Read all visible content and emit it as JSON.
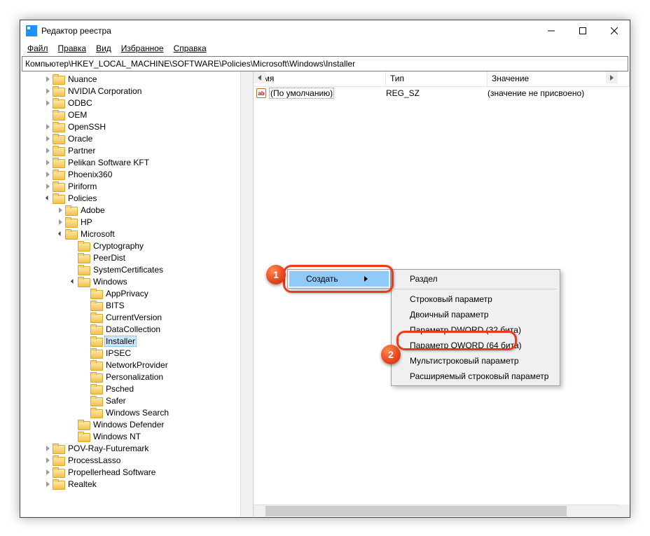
{
  "window": {
    "title": "Редактор реестра"
  },
  "menu": {
    "file": "Файл",
    "edit": "Правка",
    "view": "Вид",
    "favorites": "Избранное",
    "help": "Справка"
  },
  "address": "Компьютер\\HKEY_LOCAL_MACHINE\\SOFTWARE\\Policies\\Microsoft\\Windows\\Installer",
  "columns": {
    "name": "Имя",
    "type": "Тип",
    "value": "Значение"
  },
  "rows": [
    {
      "name": "(По умолчанию)",
      "type": "REG_SZ",
      "value": "(значение не присвоено)"
    }
  ],
  "tree": [
    {
      "d": 4,
      "tw": "closed",
      "label": "Nuance"
    },
    {
      "d": 4,
      "tw": "closed",
      "label": "NVIDIA Corporation"
    },
    {
      "d": 4,
      "tw": "closed",
      "label": "ODBC"
    },
    {
      "d": 4,
      "tw": "none",
      "label": "OEM"
    },
    {
      "d": 4,
      "tw": "closed",
      "label": "OpenSSH"
    },
    {
      "d": 4,
      "tw": "closed",
      "label": "Oracle"
    },
    {
      "d": 4,
      "tw": "closed",
      "label": "Partner"
    },
    {
      "d": 4,
      "tw": "closed",
      "label": "Pelikan Software KFT"
    },
    {
      "d": 4,
      "tw": "closed",
      "label": "Phoenix360"
    },
    {
      "d": 4,
      "tw": "closed",
      "label": "Piriform"
    },
    {
      "d": 4,
      "tw": "open",
      "label": "Policies"
    },
    {
      "d": 5,
      "tw": "closed",
      "label": "Adobe"
    },
    {
      "d": 5,
      "tw": "closed",
      "label": "HP"
    },
    {
      "d": 5,
      "tw": "open",
      "label": "Microsoft"
    },
    {
      "d": 6,
      "tw": "none",
      "label": "Cryptography"
    },
    {
      "d": 6,
      "tw": "none",
      "label": "PeerDist"
    },
    {
      "d": 6,
      "tw": "none",
      "label": "SystemCertificates"
    },
    {
      "d": 6,
      "tw": "open",
      "label": "Windows"
    },
    {
      "d": 7,
      "tw": "none",
      "label": "AppPrivacy"
    },
    {
      "d": 7,
      "tw": "none",
      "label": "BITS"
    },
    {
      "d": 7,
      "tw": "none",
      "label": "CurrentVersion"
    },
    {
      "d": 7,
      "tw": "none",
      "label": "DataCollection"
    },
    {
      "d": 7,
      "tw": "none",
      "label": "Installer",
      "selected": true
    },
    {
      "d": 7,
      "tw": "none",
      "label": "IPSEC"
    },
    {
      "d": 7,
      "tw": "none",
      "label": "NetworkProvider"
    },
    {
      "d": 7,
      "tw": "none",
      "label": "Personalization"
    },
    {
      "d": 7,
      "tw": "none",
      "label": "Psched"
    },
    {
      "d": 7,
      "tw": "none",
      "label": "Safer"
    },
    {
      "d": 7,
      "tw": "none",
      "label": "Windows Search"
    },
    {
      "d": 6,
      "tw": "none",
      "label": "Windows Defender"
    },
    {
      "d": 6,
      "tw": "none",
      "label": "Windows NT"
    },
    {
      "d": 4,
      "tw": "closed",
      "label": "POV-Ray-Futuremark"
    },
    {
      "d": 4,
      "tw": "closed",
      "label": "ProcessLasso"
    },
    {
      "d": 4,
      "tw": "closed",
      "label": "Propellerhead Software"
    },
    {
      "d": 4,
      "tw": "closed",
      "label": "Realtek"
    }
  ],
  "context": {
    "create": "Создать",
    "submenu": {
      "key": "Раздел",
      "string": "Строковый параметр",
      "binary": "Двоичный параметр",
      "dword": "Параметр DWORD (32 бита)",
      "qword": "Параметр QWORD (64 бита)",
      "multi": "Мультистроковый параметр",
      "expand": "Расширяемый строковый параметр"
    }
  },
  "badges": {
    "one": "1",
    "two": "2"
  }
}
